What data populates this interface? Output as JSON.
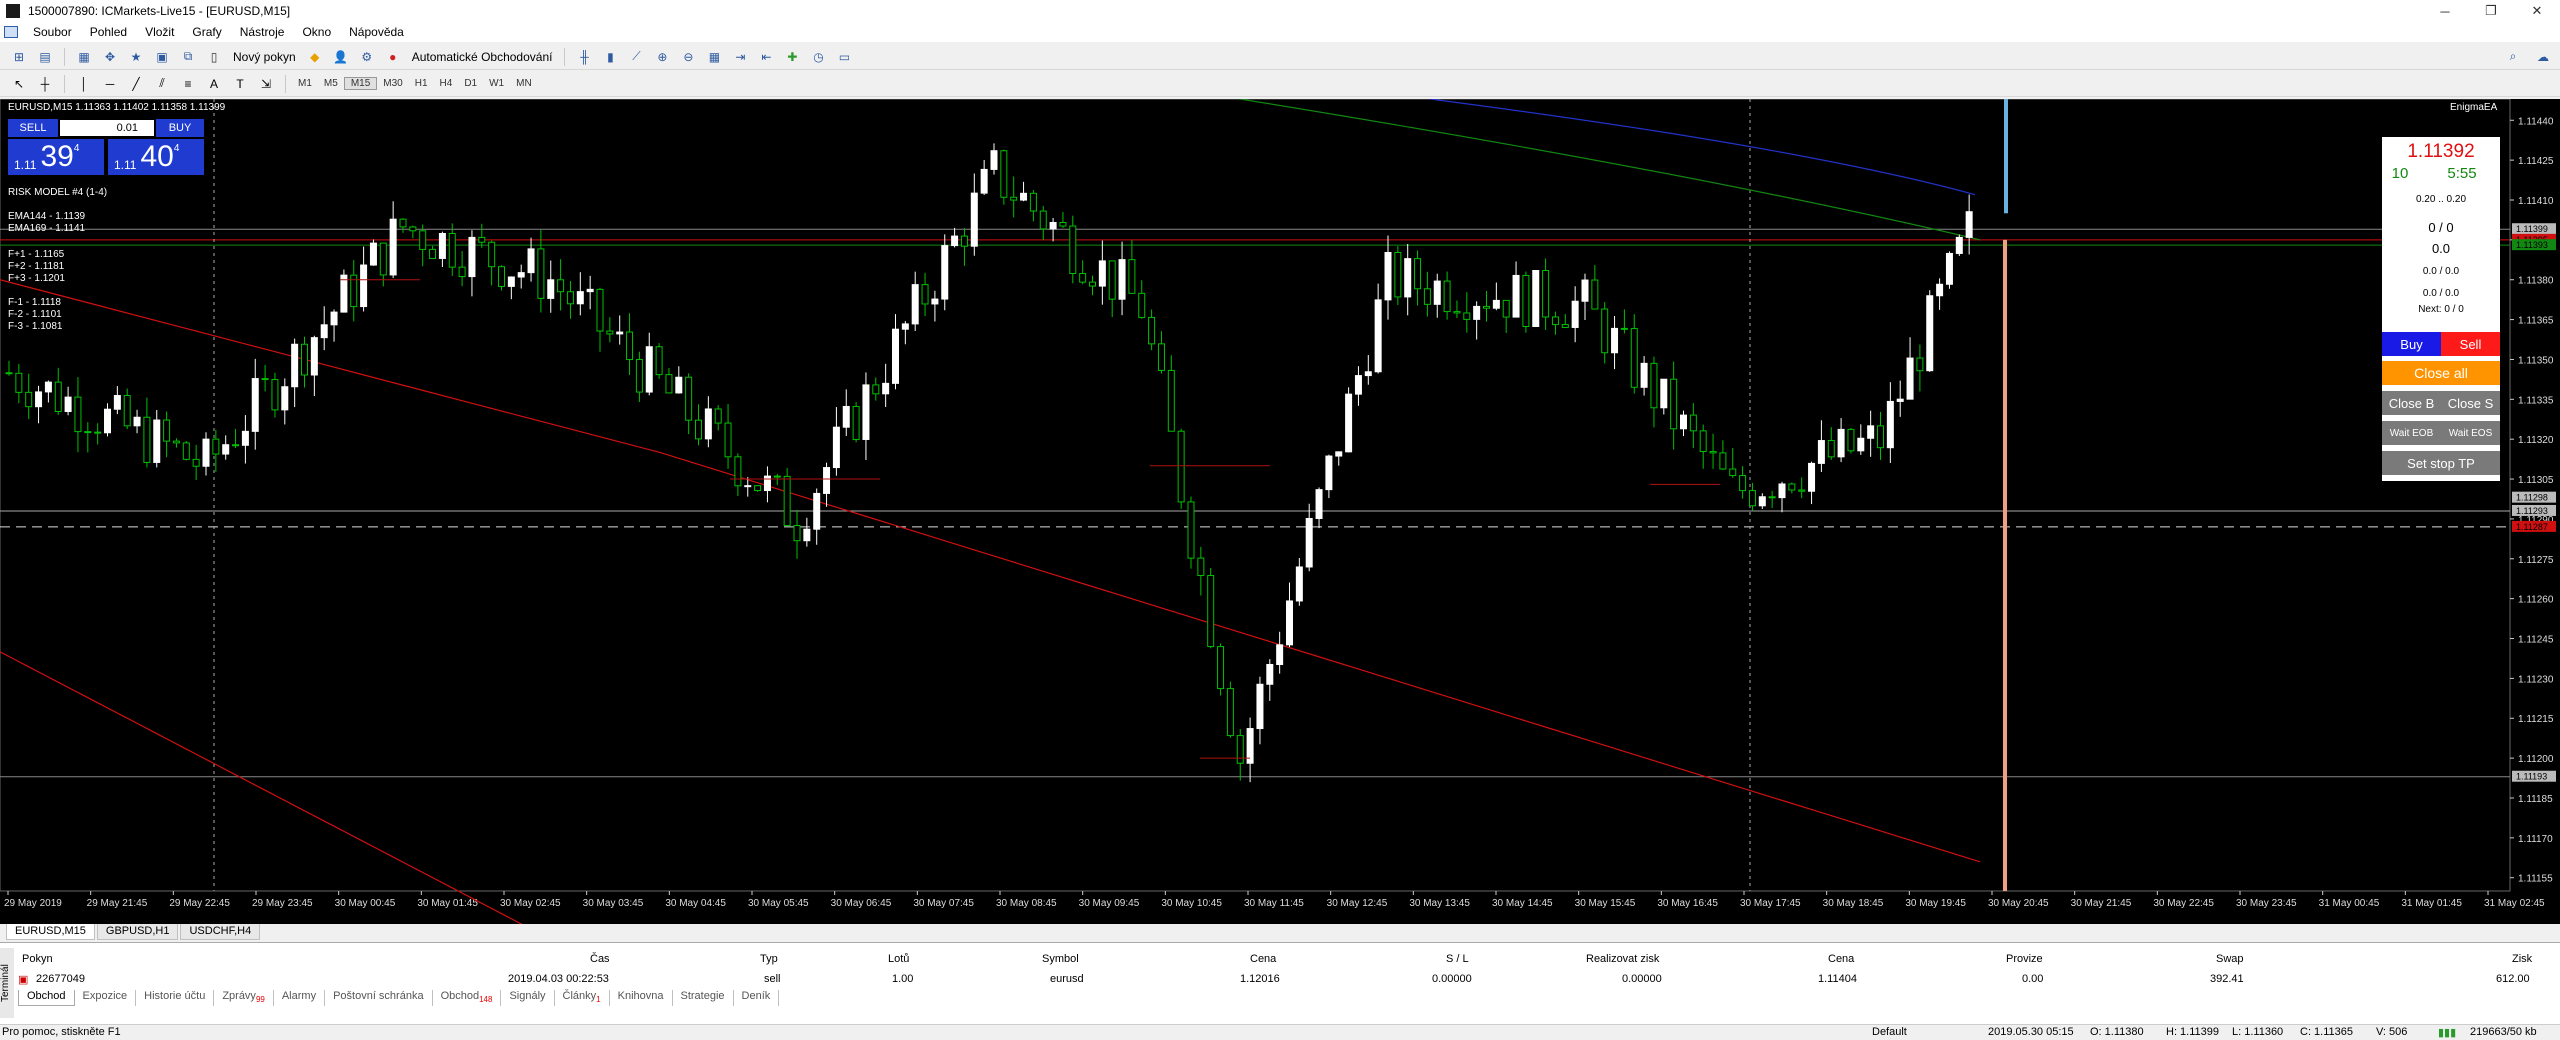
{
  "window": {
    "title": "1500007890: ICMarkets-Live15 - [EURUSD,M15]"
  },
  "menu": [
    "Soubor",
    "Pohled",
    "Vložit",
    "Grafy",
    "Nástroje",
    "Okno",
    "Nápověda"
  ],
  "toolbar": {
    "new_order": "Nový pokyn",
    "auto_trading": "Automatické Obchodování"
  },
  "timeframes": [
    "M1",
    "M5",
    "M15",
    "M30",
    "H1",
    "H4",
    "D1",
    "W1",
    "MN"
  ],
  "chart": {
    "symbol_line": "EURUSD,M15  1.11363 1.11402 1.11358 1.11399",
    "expert": "EnigmaEA",
    "risk_model": "RISK MODEL #4 (1-4)",
    "ema": [
      "EMA144 - 1.1139",
      "EMA169 - 1.1141"
    ],
    "fib_up": [
      "F+1 - 1.1165",
      "F+2 - 1.1181",
      "F+3 - 1.1201"
    ],
    "fib_down": [
      "F-1 - 1.1118",
      "F-2 - 1.1101",
      "F-3 - 1.1081"
    ],
    "colors": {
      "bull": "#ffffff",
      "bear": "#00c000",
      "ema_red": "#d01010",
      "ema_green": "#118811",
      "ema_blue": "#2233cc"
    }
  },
  "trade_panel": {
    "sell_label": "SELL",
    "buy_label": "BUY",
    "lot": "0.01",
    "sell_small": "1.11",
    "sell_big": "39",
    "sell_sup": "4",
    "buy_small": "1.11",
    "buy_big": "40",
    "buy_sup": "4"
  },
  "chart_data": {
    "type": "candlestick",
    "y_ticks": [
      "1.11440",
      "1.11425",
      "1.11410",
      "1.11395",
      "1.11380",
      "1.11365",
      "1.11350",
      "1.11335",
      "1.11320",
      "1.11305",
      "1.11290",
      "1.11275",
      "1.11260",
      "1.11245",
      "1.11230",
      "1.11215",
      "1.11200",
      "1.11185",
      "1.11170",
      "1.11155"
    ],
    "x_ticks": [
      "29 May 2019",
      "29 May 21:45",
      "29 May 22:45",
      "29 May 23:45",
      "30 May 00:45",
      "30 May 01:45",
      "30 May 02:45",
      "30 May 03:45",
      "30 May 04:45",
      "30 May 05:45",
      "30 May 06:45",
      "30 May 07:45",
      "30 May 08:45",
      "30 May 09:45",
      "30 May 10:45",
      "30 May 11:45",
      "30 May 12:45",
      "30 May 13:45",
      "30 May 14:45",
      "30 May 15:45",
      "30 May 16:45",
      "30 May 17:45",
      "30 May 18:45",
      "30 May 19:45",
      "30 May 20:45",
      "30 May 21:45",
      "30 May 22:45",
      "30 May 23:45",
      "31 May 00:45",
      "31 May 01:45",
      "31 May 02:45"
    ],
    "ylim": [
      1.1115,
      1.11448
    ],
    "price_labels": [
      "1.11399",
      "1.11395",
      "1.11393",
      "1.11298",
      "1.11293",
      "1.11287",
      "1.11193"
    ]
  },
  "ea_panel": {
    "price": "1.11392",
    "spread": "10",
    "timer": "5:55",
    "lots": "0.20 .. 0.20",
    "orders": "0 / 0",
    "profit": "0.0",
    "row1": "0.0 / 0.0",
    "row2": "0.0 / 0.0",
    "next": "Next: 0 / 0",
    "buy": "Buy",
    "sell": "Sell",
    "close_all": "Close all",
    "close_b": "Close B",
    "close_s": "Close S",
    "wait_eob": "Wait EOB",
    "wait_eos": "Wait EOS",
    "set_stop": "Set stop TP"
  },
  "chart_tabs": [
    "EURUSD,M15",
    "GBPUSD,H1",
    "USDCHF,H4"
  ],
  "terminal": {
    "side_label": "Terminál",
    "headers": [
      "Pokyn",
      "Čas",
      "Typ",
      "Lotů",
      "Symbol",
      "Cena",
      "S / L",
      "Realizovat zisk",
      "Cena",
      "Provize",
      "Swap",
      "Zisk"
    ],
    "row": [
      "22677049",
      "2019.04.03 00:22:53",
      "sell",
      "1.00",
      "eurusd",
      "1.12016",
      "0.00000",
      "0.00000",
      "1.11404",
      "0.00",
      "392.41",
      "612.00"
    ],
    "tabs": [
      {
        "label": "Obchod",
        "badge": ""
      },
      {
        "label": "Expozice",
        "badge": ""
      },
      {
        "label": "Historie účtu",
        "badge": ""
      },
      {
        "label": "Zprávy",
        "badge": "99"
      },
      {
        "label": "Alarmy",
        "badge": ""
      },
      {
        "label": "Poštovní schránka",
        "badge": ""
      },
      {
        "label": "Obchod",
        "badge": "148"
      },
      {
        "label": "Signály",
        "badge": ""
      },
      {
        "label": "Články",
        "badge": "1"
      },
      {
        "label": "Knihovna",
        "badge": ""
      },
      {
        "label": "Strategie",
        "badge": ""
      },
      {
        "label": "Deník",
        "badge": ""
      }
    ]
  },
  "status": {
    "help": "Pro pomoc, stiskněte F1",
    "profile": "Default",
    "time": "2019.05.30 05:15",
    "open": "O: 1.11380",
    "high": "H: 1.11399",
    "low": "L: 1.11360",
    "close": "C: 1.11365",
    "volume": "V: 506",
    "traffic": "219663/50 kb"
  }
}
